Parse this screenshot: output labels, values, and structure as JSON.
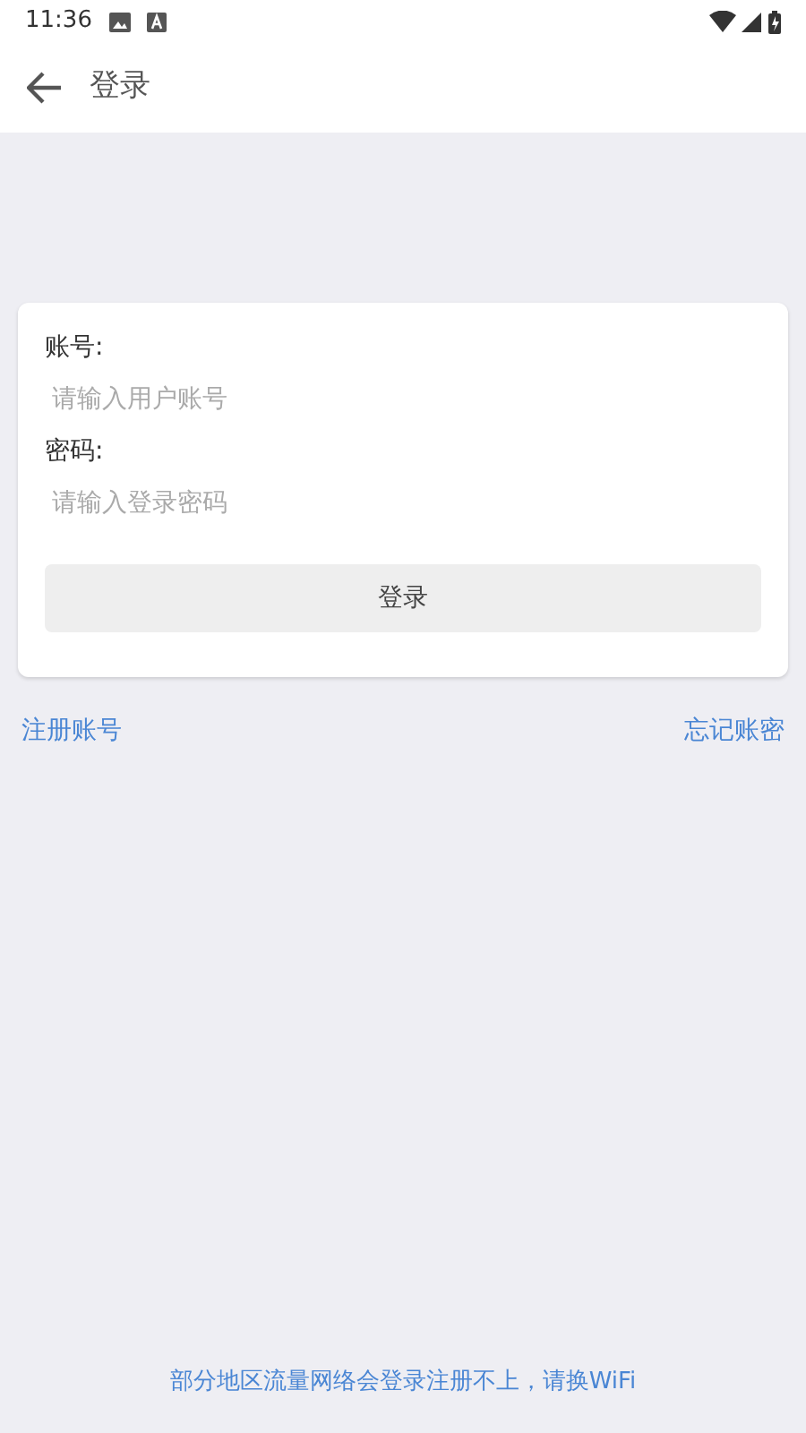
{
  "status_bar": {
    "time": "11:36"
  },
  "app_bar": {
    "title": "登录"
  },
  "form": {
    "fields": [
      {
        "label": "账号:",
        "placeholder": "请输入用户账号"
      },
      {
        "label": "密码:",
        "placeholder": "请输入登录密码"
      }
    ],
    "submit": "登录"
  },
  "links": [
    "注册账号",
    "忘记账密"
  ],
  "footer_note": "部分地区流量网络会登录注册不上，请换WiFi"
}
